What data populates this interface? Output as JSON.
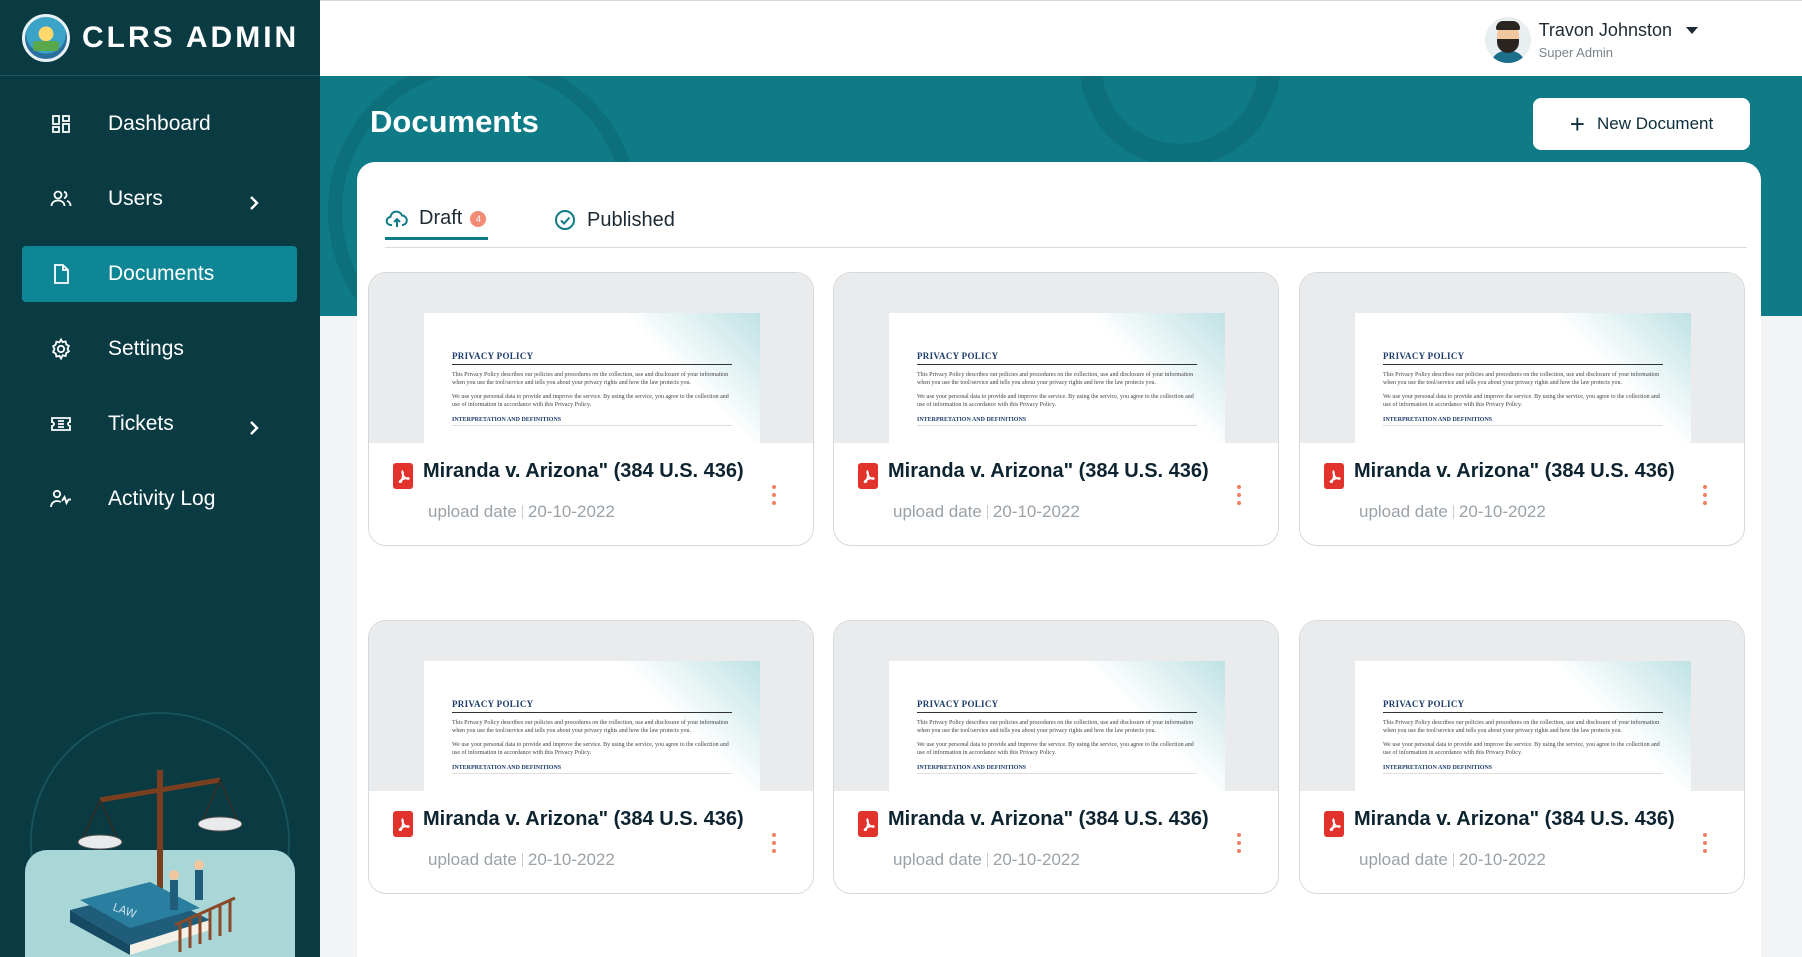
{
  "brand": {
    "name": "CLRS ADMIN"
  },
  "sidebar": {
    "items": [
      {
        "label": "Dashboard",
        "icon": "dashboard-icon",
        "active": false
      },
      {
        "label": "Users",
        "icon": "users-icon",
        "active": false,
        "has_submenu": true
      },
      {
        "label": "Documents",
        "icon": "document-icon",
        "active": true
      },
      {
        "label": "Settings",
        "icon": "gear-icon",
        "active": false
      },
      {
        "label": "Tickets",
        "icon": "ticket-icon",
        "active": false,
        "has_submenu": true
      },
      {
        "label": "Activity Log",
        "icon": "activity-log-icon",
        "active": false
      }
    ]
  },
  "user": {
    "name": "Travon Johnston",
    "role": "Super Admin"
  },
  "page": {
    "title": "Documents",
    "new_button_label": "New Document"
  },
  "tabs": [
    {
      "label": "Draft",
      "badge": "4",
      "active": true,
      "icon": "cloud-upload-icon"
    },
    {
      "label": "Published",
      "active": false,
      "icon": "check-circle-icon"
    }
  ],
  "doc_preview": {
    "heading": "PRIVACY POLICY",
    "para1": "This Privacy Policy describes our policies and procedures on the collection, use and disclosure of your information when you use the tool/service and tells you about your privacy rights and how the law protects you.",
    "para2": "We use your personal data to provide and improve the service. By using the service, you agree to the collection and use of information in accordance with this Privacy Policy.",
    "subheading": "INTERPRETATION AND DEFINITIONS"
  },
  "documents": [
    {
      "title": "Miranda v. Arizona\" (384 U.S. 436)",
      "meta_label": "upload date",
      "date": "20-10-2022"
    },
    {
      "title": "Miranda v. Arizona\" (384 U.S. 436)",
      "meta_label": "upload date",
      "date": "20-10-2022"
    },
    {
      "title": "Miranda v. Arizona\" (384 U.S. 436)",
      "meta_label": "upload date",
      "date": "20-10-2022"
    },
    {
      "title": "Miranda v. Arizona\" (384 U.S. 436)",
      "meta_label": "upload date",
      "date": "20-10-2022"
    },
    {
      "title": "Miranda v. Arizona\" (384 U.S. 436)",
      "meta_label": "upload date",
      "date": "20-10-2022"
    },
    {
      "title": "Miranda v. Arizona\" (384 U.S. 436)",
      "meta_label": "upload date",
      "date": "20-10-2022"
    }
  ],
  "colors": {
    "sidebar": "#0a3a42",
    "accent": "#0f7b87",
    "active_nav": "#0f8696",
    "badge": "#f28b74",
    "pdf": "#e1322c"
  }
}
